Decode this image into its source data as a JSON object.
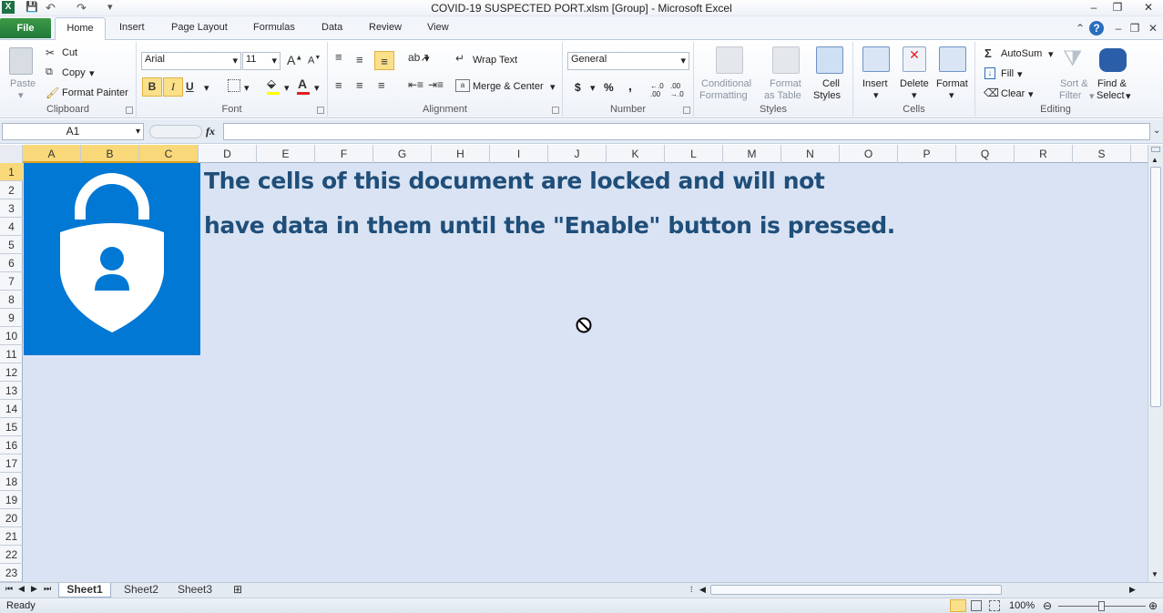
{
  "window": {
    "title": "COVID-19 SUSPECTED PORT.xlsm  [Group]  -  Microsoft Excel",
    "minimize": "–",
    "restore": "❐",
    "close": "✕"
  },
  "qat": {
    "save": "💾",
    "undo": "↶",
    "redo": "↷"
  },
  "tabs": {
    "file": "File",
    "items": [
      "Home",
      "Insert",
      "Page Layout",
      "Formulas",
      "Data",
      "Review",
      "View"
    ]
  },
  "ribbon": {
    "clipboard": {
      "paste": "Paste",
      "cut": "Cut",
      "copy": "Copy",
      "format_painter": "Format Painter",
      "label": "Clipboard"
    },
    "font": {
      "name": "Arial",
      "size": "11",
      "bold": "B",
      "italic": "I",
      "underline": "U",
      "label": "Font"
    },
    "alignment": {
      "wrap_text": "Wrap Text",
      "merge_center": "Merge & Center",
      "label": "Alignment"
    },
    "number": {
      "format": "General",
      "currency": "$",
      "percent": "%",
      "comma": ",",
      "inc_dec": ".0→.00",
      "dec_dec": ".00→.0",
      "label": "Number"
    },
    "styles": {
      "conditional_1": "Conditional",
      "conditional_2": "Formatting",
      "format_table_1": "Format",
      "format_table_2": "as Table",
      "cell_styles_1": "Cell",
      "cell_styles_2": "Styles",
      "label": "Styles"
    },
    "cells": {
      "insert": "Insert",
      "delete": "Delete",
      "format": "Format",
      "label": "Cells"
    },
    "editing": {
      "autosum": "AutoSum",
      "fill": "Fill",
      "clear": "Clear",
      "sort_1": "Sort &",
      "sort_2": "Filter",
      "find_1": "Find &",
      "find_2": "Select",
      "label": "Editing"
    }
  },
  "formula_bar": {
    "name_box": "A1",
    "fx": "fx",
    "value": ""
  },
  "columns": [
    "A",
    "B",
    "C",
    "D",
    "E",
    "F",
    "G",
    "H",
    "I",
    "J",
    "K",
    "L",
    "M",
    "N",
    "O",
    "P",
    "Q",
    "R",
    "S"
  ],
  "rows": [
    "1",
    "2",
    "3",
    "4",
    "5",
    "6",
    "7",
    "8",
    "9",
    "10",
    "11",
    "12",
    "13",
    "14",
    "15",
    "16",
    "17",
    "18",
    "19",
    "20",
    "21",
    "22",
    "23"
  ],
  "content": {
    "line1": "The cells of this document are locked and will not",
    "line2": "have data in them until the \"Enable\" button is pressed."
  },
  "sheets": [
    "Sheet1",
    "Sheet2",
    "Sheet3"
  ],
  "status": {
    "ready": "Ready",
    "zoom": "100%"
  },
  "colors": {
    "lock_bg": "#0078d4",
    "sheet_bg": "#dae3f3",
    "text": "#1f4e79"
  }
}
